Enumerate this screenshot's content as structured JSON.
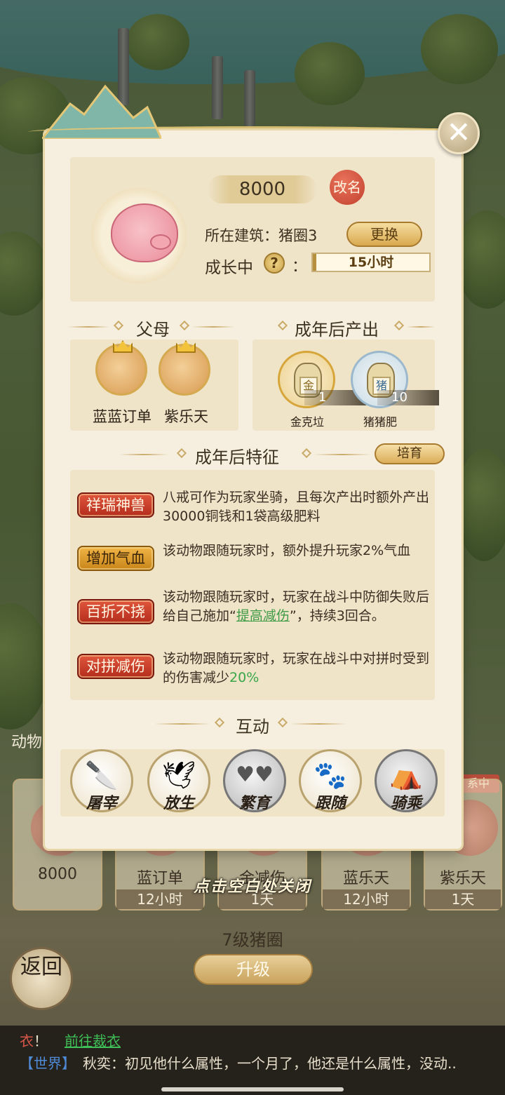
{
  "pet": {
    "price": "8000",
    "rename_label": "改名",
    "building_label": "所在建筑：猪圈3",
    "change_label": "更换",
    "status_label": "成长中",
    "colon": "：",
    "growth_time": "15小时",
    "growth_progress_pct": 3
  },
  "sections": {
    "parents": "父母",
    "adult_output": "成年后产出",
    "adult_traits": "成年后特征",
    "interaction": "互动"
  },
  "parents": [
    {
      "name": "蓝蓝订单"
    },
    {
      "name": "紫乐天"
    }
  ],
  "outputs": [
    {
      "name": "金克垃",
      "badge_char": "金",
      "count": "1"
    },
    {
      "name": "猪猪肥",
      "badge_char": "猪",
      "count": "10"
    }
  ],
  "breed_label": "培育",
  "traits": [
    {
      "badge": "祥瑞神兽",
      "color": "red",
      "text": "八戒可作为玩家坐骑，且每次产出时额外产出30000铜钱和1袋高级肥料"
    },
    {
      "badge": "增加气血",
      "color": "orange",
      "text": "该动物跟随玩家时，额外提升玩家2%气血"
    },
    {
      "badge": "百折不挠",
      "color": "red",
      "text_before": "该动物跟随玩家时，玩家在战斗中防御失败后给自己施加“",
      "link": "提高减伤",
      "text_after": "”，持续3回合。"
    },
    {
      "badge": "对拼减伤",
      "color": "red",
      "text_before": "该动物跟随玩家时，玩家在战斗中对拼时受到的伤害减少",
      "highlight": "20%"
    }
  ],
  "actions": [
    {
      "label": "屠宰",
      "icon": "cleaver-icon",
      "glyph": "🔪"
    },
    {
      "label": "放生",
      "icon": "bird-icon",
      "glyph": "🕊"
    },
    {
      "label": "繁育",
      "icon": "hearts-icon",
      "glyph": "♥♥"
    },
    {
      "label": "跟随",
      "icon": "pawprints-icon",
      "glyph": "🐾"
    },
    {
      "label": "骑乘",
      "icon": "saddle-icon",
      "glyph": "⛺"
    }
  ],
  "close_hint": "点击空白处关闭",
  "background": {
    "animals_label": "动物",
    "cards": [
      {
        "name": "8000",
        "time": ""
      },
      {
        "name": "蓝订单",
        "time": "12小时"
      },
      {
        "name": "金减伤",
        "time": "1天"
      },
      {
        "name": "蓝乐天",
        "time": "12小时"
      },
      {
        "name": "紫乐天",
        "time": "1天"
      }
    ],
    "tag": "系中",
    "level": "7级猪圈",
    "upgrade": "升级",
    "back": "返回"
  },
  "chat": {
    "line1_red": "衣",
    "line1_mid": "！",
    "line1_link": "前往裁衣",
    "channel": "【世界】",
    "message": "秋奕：初见他什么属性，一个月了，他还是什么属性，没动.."
  },
  "colors": {
    "accent_gold": "#c9aa69",
    "badge_red": "#c23a26",
    "badge_orange": "#e3a137",
    "link_green": "#3d9b45"
  }
}
